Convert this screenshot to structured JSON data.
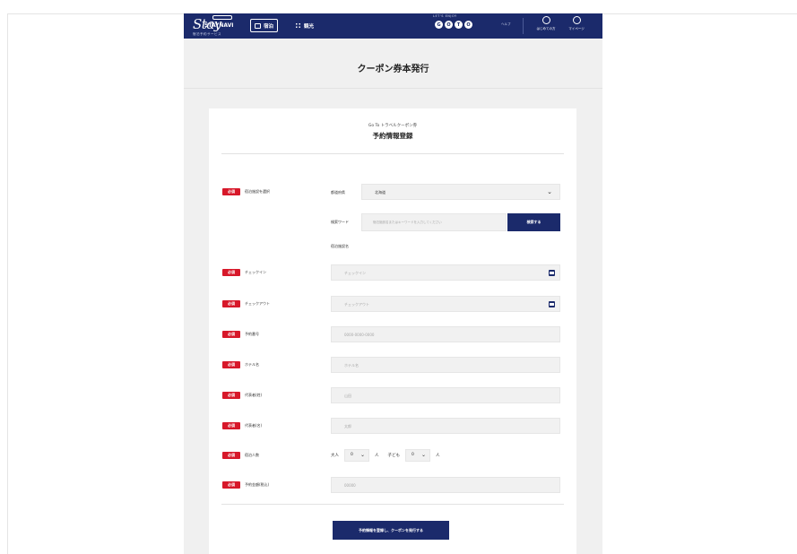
{
  "header": {
    "logo_main": "Stay",
    "logo_name": "STAYNAVI",
    "logo_sub": "宿泊予約サービス",
    "tabs": [
      {
        "label": "宿泊",
        "icon": "calendar-icon",
        "active": true
      },
      {
        "label": "観光",
        "icon": "grid-icon",
        "active": false
      }
    ],
    "go_label": "LET'S ENJOY",
    "go_badges": [
      "G",
      "O",
      "T",
      "O"
    ],
    "help_label": "ヘルプ",
    "guide_label": "はじめての方",
    "mypage_label": "マイページ"
  },
  "page_title": "クーポン券本発行",
  "card": {
    "subtitle": "Go To トラベルクーポン券",
    "title": "予約情報登録"
  },
  "form": {
    "required_badge": "必須",
    "facility_label": "宿泊施設を選択",
    "prefecture_label": "都道府県",
    "prefecture_value": "北海道",
    "keyword_label": "検索ワード",
    "keyword_placeholder": "宿泊施設名またはキーワードを入力してください",
    "search_button": "検索する",
    "facility_name_label": "宿泊施設名",
    "checkin_label": "チェックイン",
    "checkin_placeholder": "チェックイン",
    "checkout_label": "チェックアウト",
    "checkout_placeholder": "チェックアウト",
    "reservation_no_label": "予約番号",
    "reservation_no_placeholder": "0000-0000-0000",
    "hotel_label": "ホテル名",
    "hotel_placeholder": "ホテル名",
    "rep_last_label": "代表者(姓)",
    "rep_last_placeholder": "山田",
    "rep_first_label": "代表者(名)",
    "rep_first_placeholder": "太郎",
    "guests_label": "宿泊人数",
    "adult_label": "大人",
    "adult_value": "0",
    "child_label": "子ども",
    "child_value": "0",
    "unit": "人",
    "amount_label": "予約金額(税込)",
    "amount_placeholder": "00000",
    "submit_button": "予約情報を登録し、クーポンを発行する"
  },
  "colors": {
    "brand_navy": "#1b2a6b",
    "required_red": "#d7182a"
  }
}
